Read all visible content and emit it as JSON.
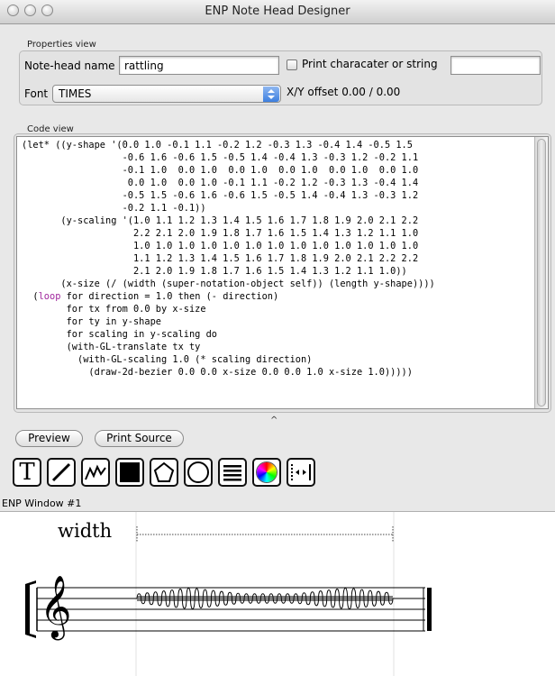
{
  "window": {
    "title": "ENP Note Head Designer"
  },
  "properties": {
    "section_label": "Properties view",
    "note_head_label": "Note-head name",
    "note_head_value": "rattling",
    "print_checkbox_label": "Print characater or string",
    "print_string_value": "",
    "font_label": "Font",
    "font_value": "TIMES",
    "offset_label": "X/Y offset",
    "offset_value": "0.00 / 0.00"
  },
  "code": {
    "section_label": "Code view",
    "lines": [
      "(let* ((y-shape '(0.0 1.0 -0.1 1.1 -0.2 1.2 -0.3 1.3 -0.4 1.4 -0.5 1.5",
      "                  -0.6 1.6 -0.6 1.5 -0.5 1.4 -0.4 1.3 -0.3 1.2 -0.2 1.1",
      "                  -0.1 1.0  0.0 1.0  0.0 1.0  0.0 1.0  0.0 1.0  0.0 1.0",
      "                   0.0 1.0  0.0 1.0 -0.1 1.1 -0.2 1.2 -0.3 1.3 -0.4 1.4",
      "                  -0.5 1.5 -0.6 1.6 -0.6 1.5 -0.5 1.4 -0.4 1.3 -0.3 1.2",
      "                  -0.2 1.1 -0.1))",
      "       (y-scaling '(1.0 1.1 1.2 1.3 1.4 1.5 1.6 1.7 1.8 1.9 2.0 2.1 2.2",
      "                    2.2 2.1 2.0 1.9 1.8 1.7 1.6 1.5 1.4 1.3 1.2 1.1 1.0",
      "                    1.0 1.0 1.0 1.0 1.0 1.0 1.0 1.0 1.0 1.0 1.0 1.0 1.0",
      "                    1.1 1.2 1.3 1.4 1.5 1.6 1.7 1.8 1.9 2.0 2.1 2.2 2.2",
      "                    2.1 2.0 1.9 1.8 1.7 1.6 1.5 1.4 1.3 1.2 1.1 1.0))",
      "       (x-size (/ (width (super-notation-object self)) (length y-shape))))",
      "  (loop for direction = 1.0 then (- direction)",
      "        for tx from 0.0 by x-size",
      "        for ty in y-shape",
      "        for scaling in y-scaling do",
      "        (with-GL-translate tx ty",
      "          (with-GL-scaling 1.0 (* scaling direction)",
      "            (draw-2d-bezier 0.0 0.0 x-size 0.0 0.0 1.0 x-size 1.0)))))"
    ]
  },
  "buttons": {
    "preview": "Preview",
    "print_source": "Print Source",
    "splitter": "^"
  },
  "tools": [
    {
      "name": "text-tool",
      "glyph": "T"
    },
    {
      "name": "line-tool"
    },
    {
      "name": "polyline-tool"
    },
    {
      "name": "filled-rect-tool"
    },
    {
      "name": "polygon-tool"
    },
    {
      "name": "circle-tool"
    },
    {
      "name": "lines-tool"
    },
    {
      "name": "color-picker-tool"
    },
    {
      "name": "spacing-tool"
    }
  ],
  "enp": {
    "window_label": "ENP Window #1",
    "width_label": "width"
  },
  "colors": {
    "code_keyword": "#a0259c"
  }
}
